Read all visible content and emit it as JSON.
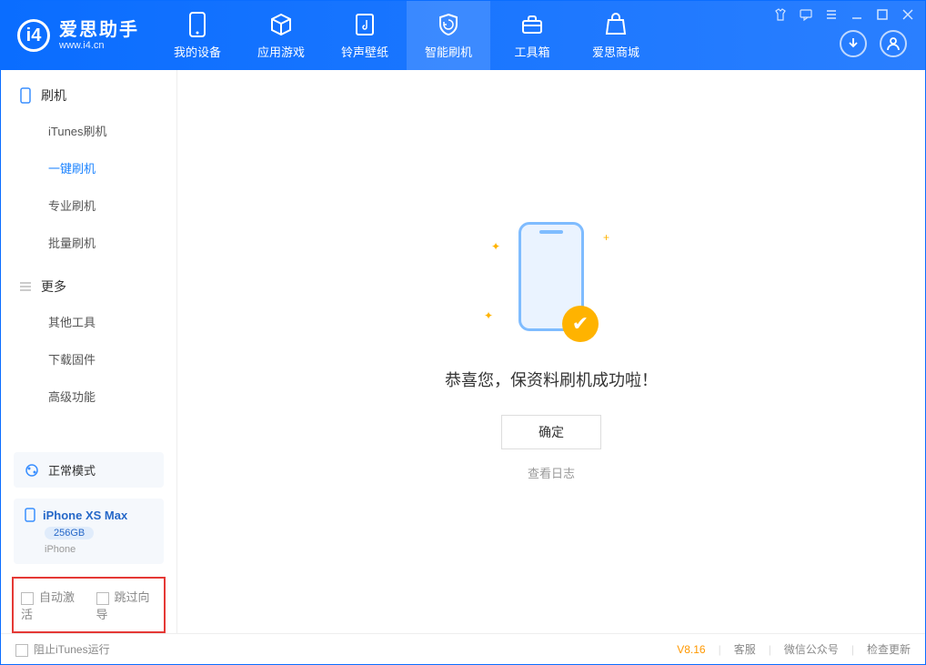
{
  "logo": {
    "name": "爱思助手",
    "url": "www.i4.cn",
    "letter": "i4"
  },
  "nav": {
    "tabs": [
      {
        "label": "我的设备",
        "icon": "device"
      },
      {
        "label": "应用游戏",
        "icon": "cube"
      },
      {
        "label": "铃声壁纸",
        "icon": "music"
      },
      {
        "label": "智能刷机",
        "icon": "shield"
      },
      {
        "label": "工具箱",
        "icon": "toolbox"
      },
      {
        "label": "爱思商城",
        "icon": "bag"
      }
    ],
    "active_index": 3
  },
  "sidebar": {
    "group1_title": "刷机",
    "group1_items": [
      "iTunes刷机",
      "一键刷机",
      "专业刷机",
      "批量刷机"
    ],
    "group1_active": 1,
    "group2_title": "更多",
    "group2_items": [
      "其他工具",
      "下载固件",
      "高级功能"
    ],
    "mode_label": "正常模式",
    "device": {
      "name": "iPhone XS Max",
      "storage": "256GB",
      "type": "iPhone"
    },
    "cb1": "自动激活",
    "cb2": "跳过向导"
  },
  "main": {
    "success_text": "恭喜您，保资料刷机成功啦！",
    "ok_button": "确定",
    "log_link": "查看日志"
  },
  "footer": {
    "block_itunes": "阻止iTunes运行",
    "version": "V8.16",
    "links": [
      "客服",
      "微信公众号",
      "检查更新"
    ]
  }
}
